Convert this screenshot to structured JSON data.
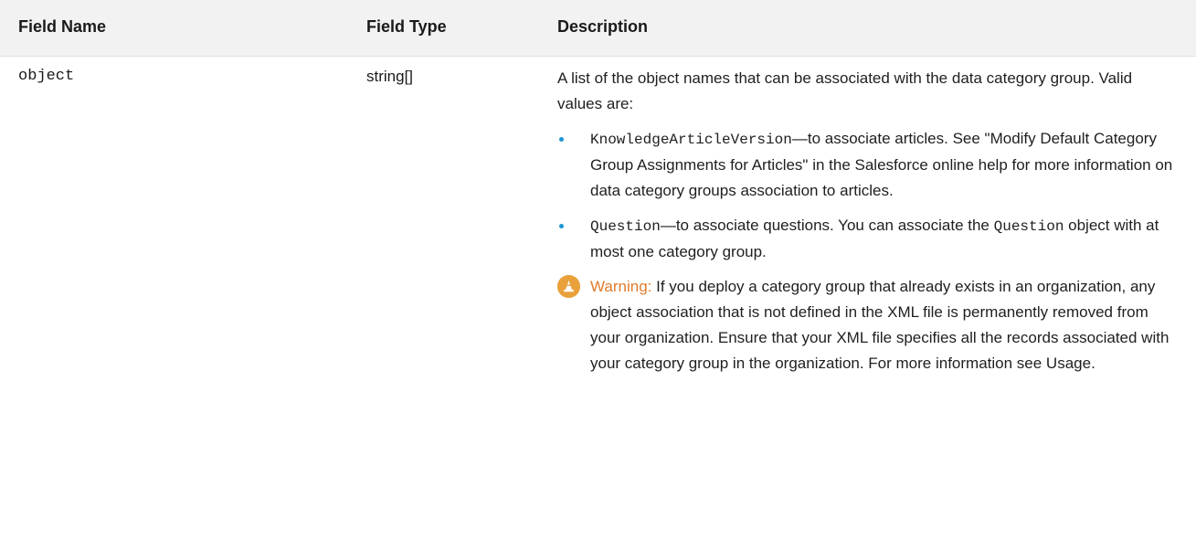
{
  "table": {
    "headers": {
      "name": "Field Name",
      "type": "Field Type",
      "description": "Description"
    },
    "row": {
      "name": "object",
      "type": "string[]",
      "description_intro": "A list of the object names that can be associated with the data category group. Valid values are:",
      "bullets": [
        {
          "code": "KnowledgeArticleVersion",
          "text": "—to associate articles. See \"Modify Default Category Group Assignments for Articles\" in the Salesforce online help for more information on data category groups association to articles."
        },
        {
          "code": "Question",
          "text_before": "—to associate questions. You can associate the ",
          "code_inline": "Question",
          "text_after": " object with at most one category group."
        }
      ],
      "warning": {
        "icon": "warning-cone-icon",
        "label": "Warning:",
        "text": "If you deploy a category group that already exists in an organization, any object association that is not defined in the XML file is permanently removed from your organization. Ensure that your XML file specifies all the records associated with your category group in the organization. For more information see Usage."
      }
    }
  },
  "colors": {
    "header_bg": "#f2f2f2",
    "bullet": "#1b96d3",
    "warning_icon": "#e8a13b",
    "warning_label": "#e07b2c"
  }
}
